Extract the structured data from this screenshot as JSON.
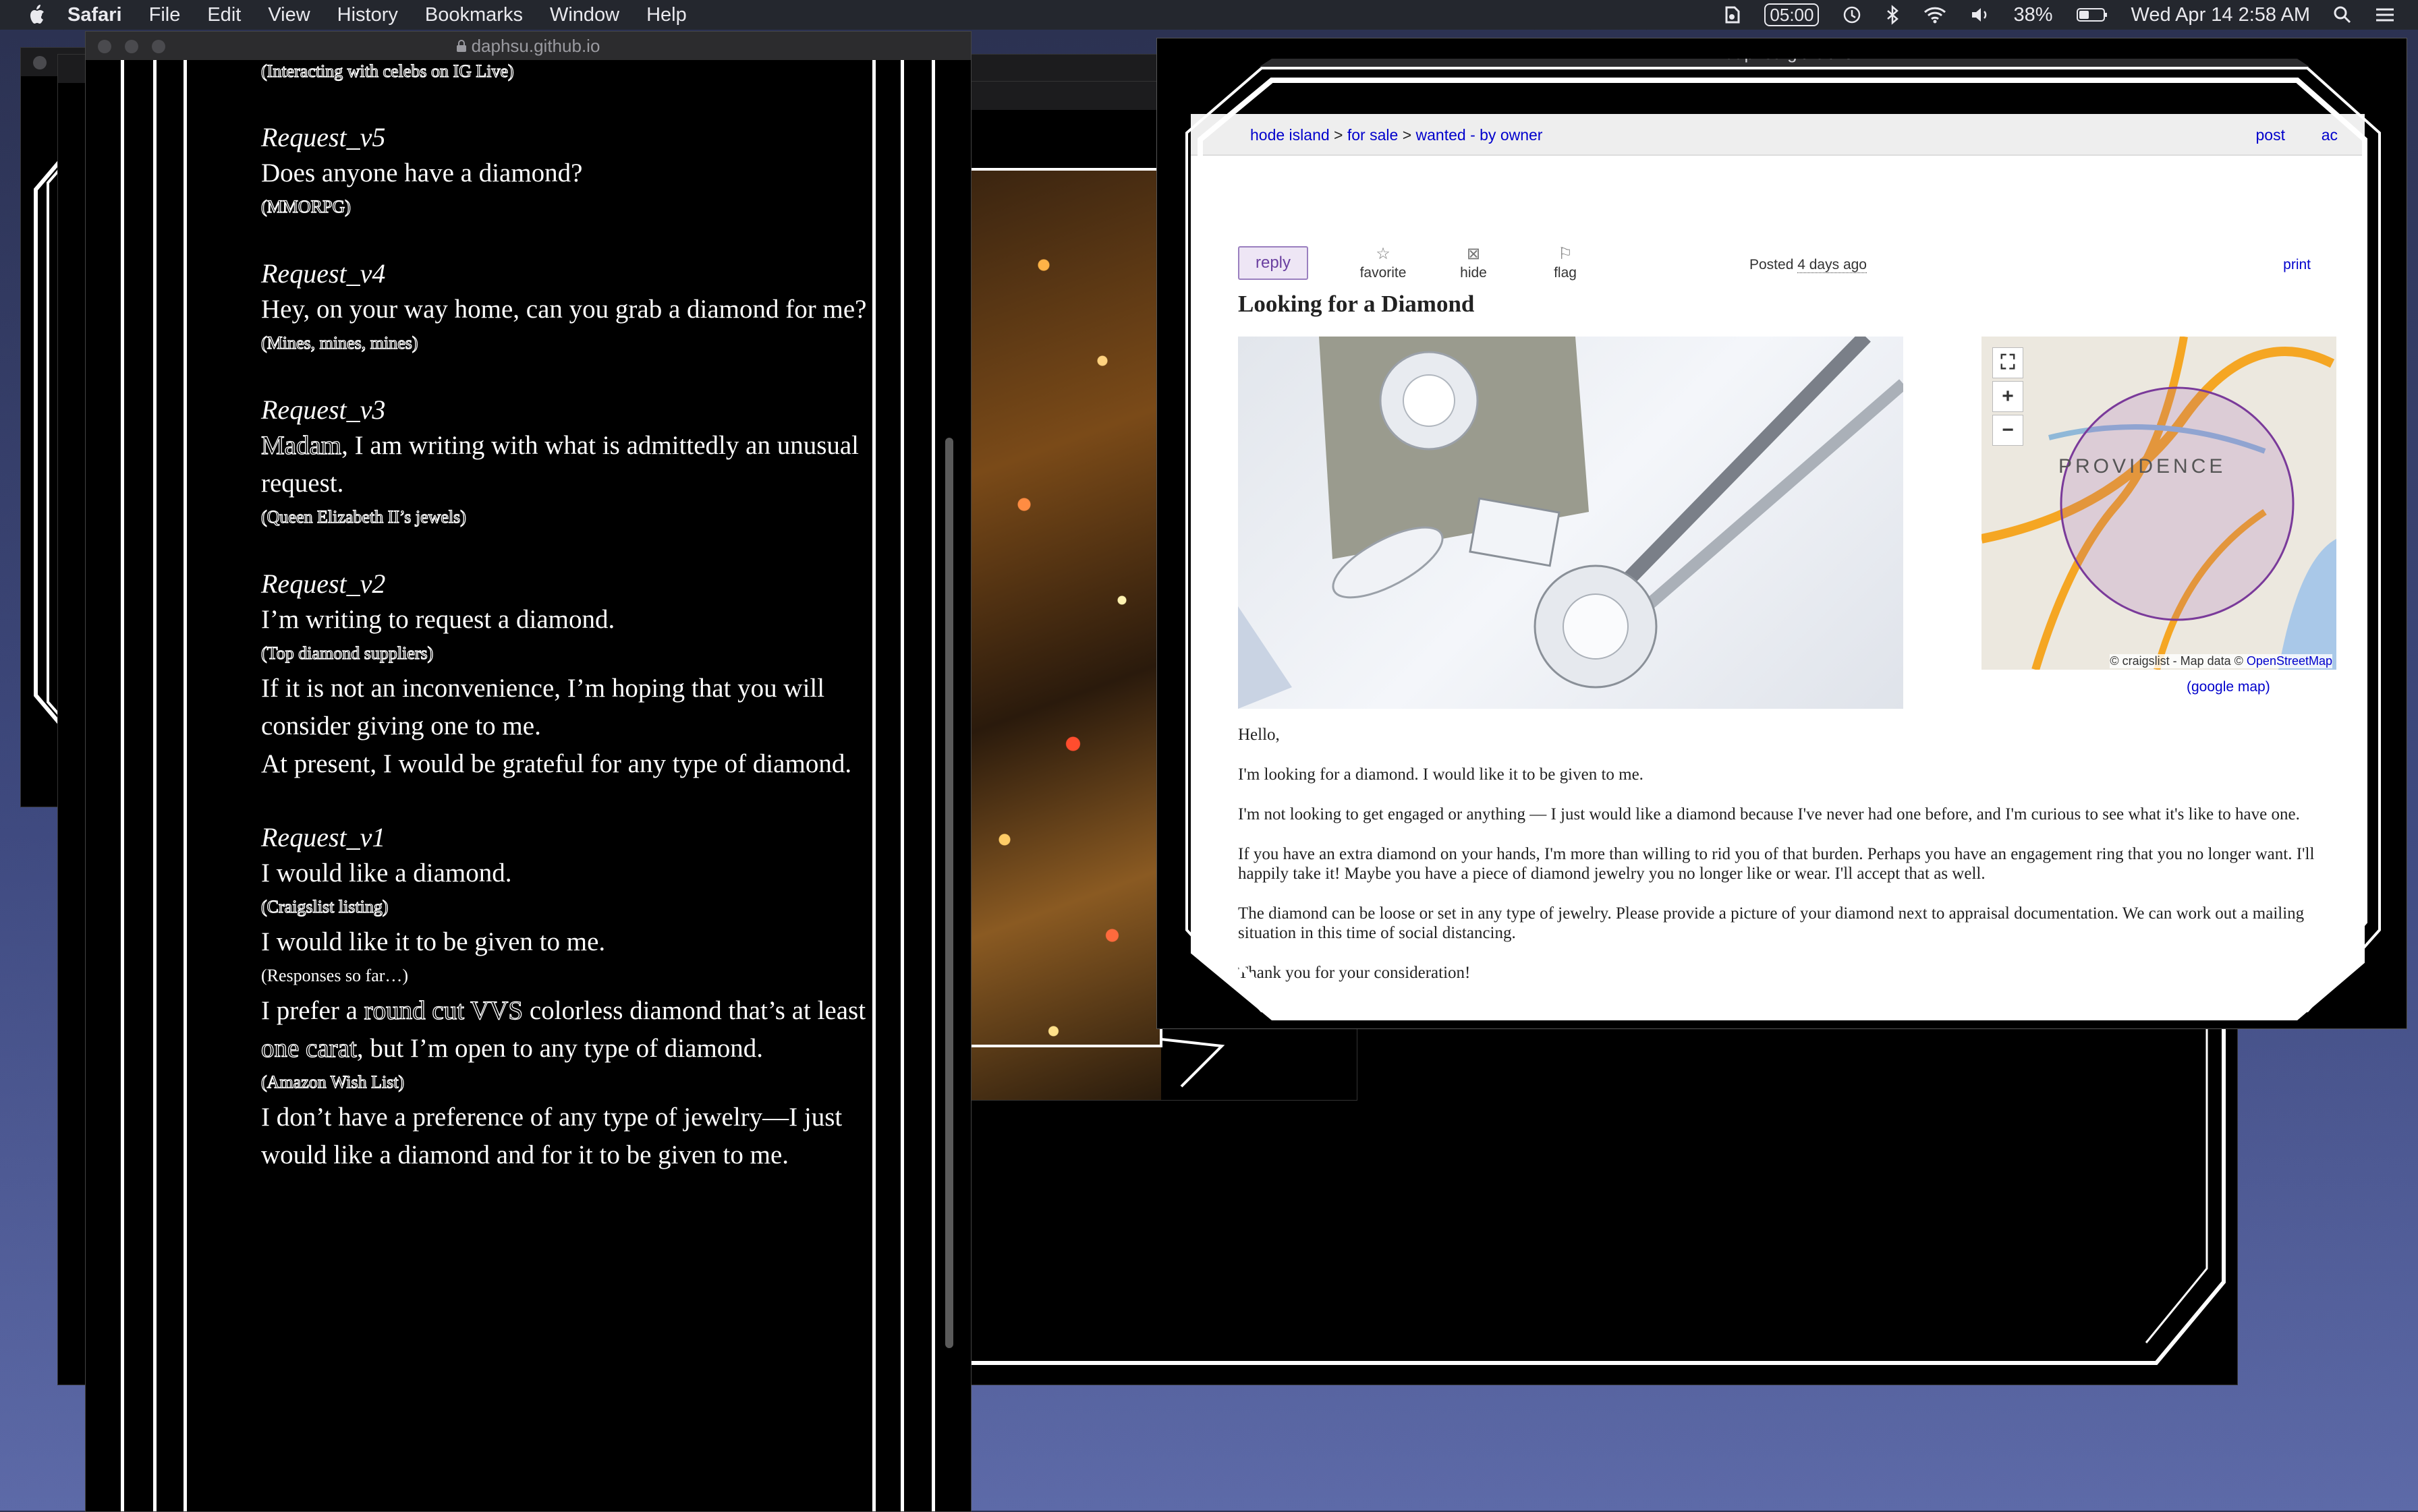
{
  "menubar": {
    "app": "Safari",
    "items": [
      "File",
      "Edit",
      "View",
      "History",
      "Bookmarks",
      "Window",
      "Help"
    ],
    "timer": "05:00",
    "battery": "38%",
    "datetime": "Wed Apr 14  2:58 AM"
  },
  "left_window": {
    "url": "daphsu.github.io",
    "partial_top": "(Interacting with celebs on IG Live)",
    "requests": [
      {
        "title": "Request_v5",
        "body": "Does anyone have a diamond?",
        "note": "(MMORPG)"
      },
      {
        "title": "Request_v4",
        "body": "Hey, on your way home, can you grab a diamond for me?",
        "note": "(Mines, mines, mines)"
      },
      {
        "title": "Request_v3",
        "body_lead": "Madam",
        "body": ", I am writing with what is admittedly an unusual request.",
        "note": "(Queen Elizabeth II’s jewels)"
      },
      {
        "title": "Request_v2",
        "body": "I’m writing to request a diamond.",
        "note": "(Top diamond suppliers)",
        "body2": "If it is not an inconvenience, I’m hoping that you will consider giving one to me.",
        "body3": "At present, I would be grateful for any type of diamond."
      },
      {
        "title": "Request_v1",
        "body": "I would like a diamond.",
        "note": "(Craigslist listing)",
        "body2": "I would like it to be given to me.",
        "note2": "(Responses so far…)",
        "body3_a": "I prefer a ",
        "body3_b": "round cut VVS",
        "body3_c": " colorless diamond that’s at least ",
        "body3_d": "one carat",
        "body3_e": ", but I’m open to any type of diamond.",
        "note3": "(Amazon Wish List)",
        "body4": "I don’t have a preference of any type of jewelry—I just would like a diamond and for it to be given to me."
      }
    ]
  },
  "cl_window": {
    "url": "daphsu.github.io",
    "breadcrumbs": [
      "rhode island",
      "for sale",
      "wanted - by owner"
    ],
    "crumb_display": [
      "hode island",
      "for sale",
      "wanted - by owner"
    ],
    "post": "post",
    "account": "ac",
    "reply": "reply",
    "favorite": "favorite",
    "hide": "hide",
    "flag": "flag",
    "posted_label": "Posted",
    "posted_value": "4 days ago",
    "print": "print",
    "title": "Looking for a Diamond",
    "map_label": "PROVIDENCE",
    "map_attr_prefix": "© craigslist - Map data ©",
    "map_attr_link": "OpenStreetMap",
    "google_map": "(google map)",
    "body": [
      "Hello,",
      "I'm looking for a diamond. I would like it to be given to me.",
      "I'm not looking to get engaged or anything — I just would like a diamond because I've never had one before, and I'm curious to see what it's like to have one.",
      "If you have an extra diamond on your hands, I'm more than willing to rid you of that burden. Perhaps you have an engagement ring that you no longer want. I'll happily take it! Maybe you have a piece of diamond jewelry you no longer like or wear. I'll accept that as well.",
      "The diamond can be loose or set in any type of jewelry. Please provide a picture of your diamond next to appraisal documentation. We can work out a mailing situation in this time of social distancing.",
      "Thank you for your consideration!"
    ]
  },
  "colors": {
    "menubar": "#24272e",
    "link": "#0000cc",
    "reply_border": "#9a7fbf",
    "map_circle": "#7a3a9a"
  }
}
